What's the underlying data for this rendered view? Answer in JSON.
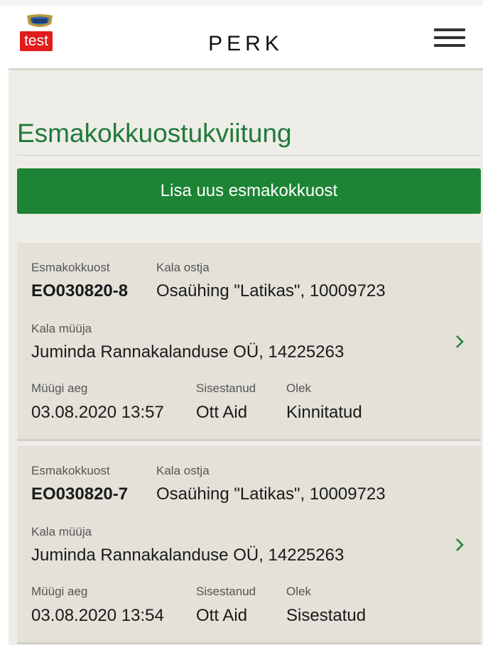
{
  "header": {
    "badge": "test",
    "brand": "PERK"
  },
  "page": {
    "title": "Esmakokkuostukviitung",
    "add_button": "Lisa uus esmakokkuost"
  },
  "labels": {
    "purchase": "Esmakokkuost",
    "buyer": "Kala ostja",
    "seller": "Kala müüja",
    "sale_time": "Müügi aeg",
    "entered_by": "Sisestanud",
    "status": "Olek"
  },
  "cards": [
    {
      "purchase_id": "EO030820-8",
      "buyer": "Osaühing \"Latikas\", 10009723",
      "seller": "Juminda Rannakalanduse OÜ, 14225263",
      "sale_time": "03.08.2020 13:57",
      "entered_by": "Ott Aid",
      "status": "Kinnitatud"
    },
    {
      "purchase_id": "EO030820-7",
      "buyer": "Osaühing \"Latikas\", 10009723",
      "seller": "Juminda Rannakalanduse OÜ, 14225263",
      "sale_time": "03.08.2020 13:54",
      "entered_by": "Ott Aid",
      "status": "Sisestatud"
    }
  ],
  "icons": {
    "logo": "coat-of-arms-icon",
    "menu": "hamburger-menu-icon",
    "card_arrow": "chevron-right-icon"
  },
  "colors": {
    "accent_green": "#1d8436",
    "title_green": "#1f7a3a",
    "badge_red": "#e21b1b",
    "page_bg": "#efede7",
    "card_bg": "#e3e1d8"
  }
}
